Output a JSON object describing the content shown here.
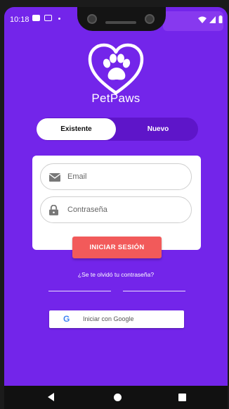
{
  "status_bar": {
    "time": "10:18",
    "icons": [
      "message-icon",
      "card-icon",
      "dot-icon",
      "wifi-icon",
      "signal-icon",
      "battery-icon"
    ]
  },
  "app": {
    "name": "PetPaws",
    "logo_icon": "paw-heart-icon"
  },
  "segment": {
    "active_label": "Existente",
    "inactive_label": "Nuevo"
  },
  "form": {
    "email_placeholder": "Email",
    "password_placeholder": "Contraseña",
    "submit_label": "INICIAR SESIÓN"
  },
  "forgot_password": "¿Se te olvidó tu contraseña?",
  "google": {
    "glyph": "G",
    "label": "Iniciar con Google"
  },
  "colors": {
    "background": "#7325ea",
    "segment_bg": "#5e15c9",
    "button": "#f25a5a",
    "google_blue": "#4285f4"
  }
}
